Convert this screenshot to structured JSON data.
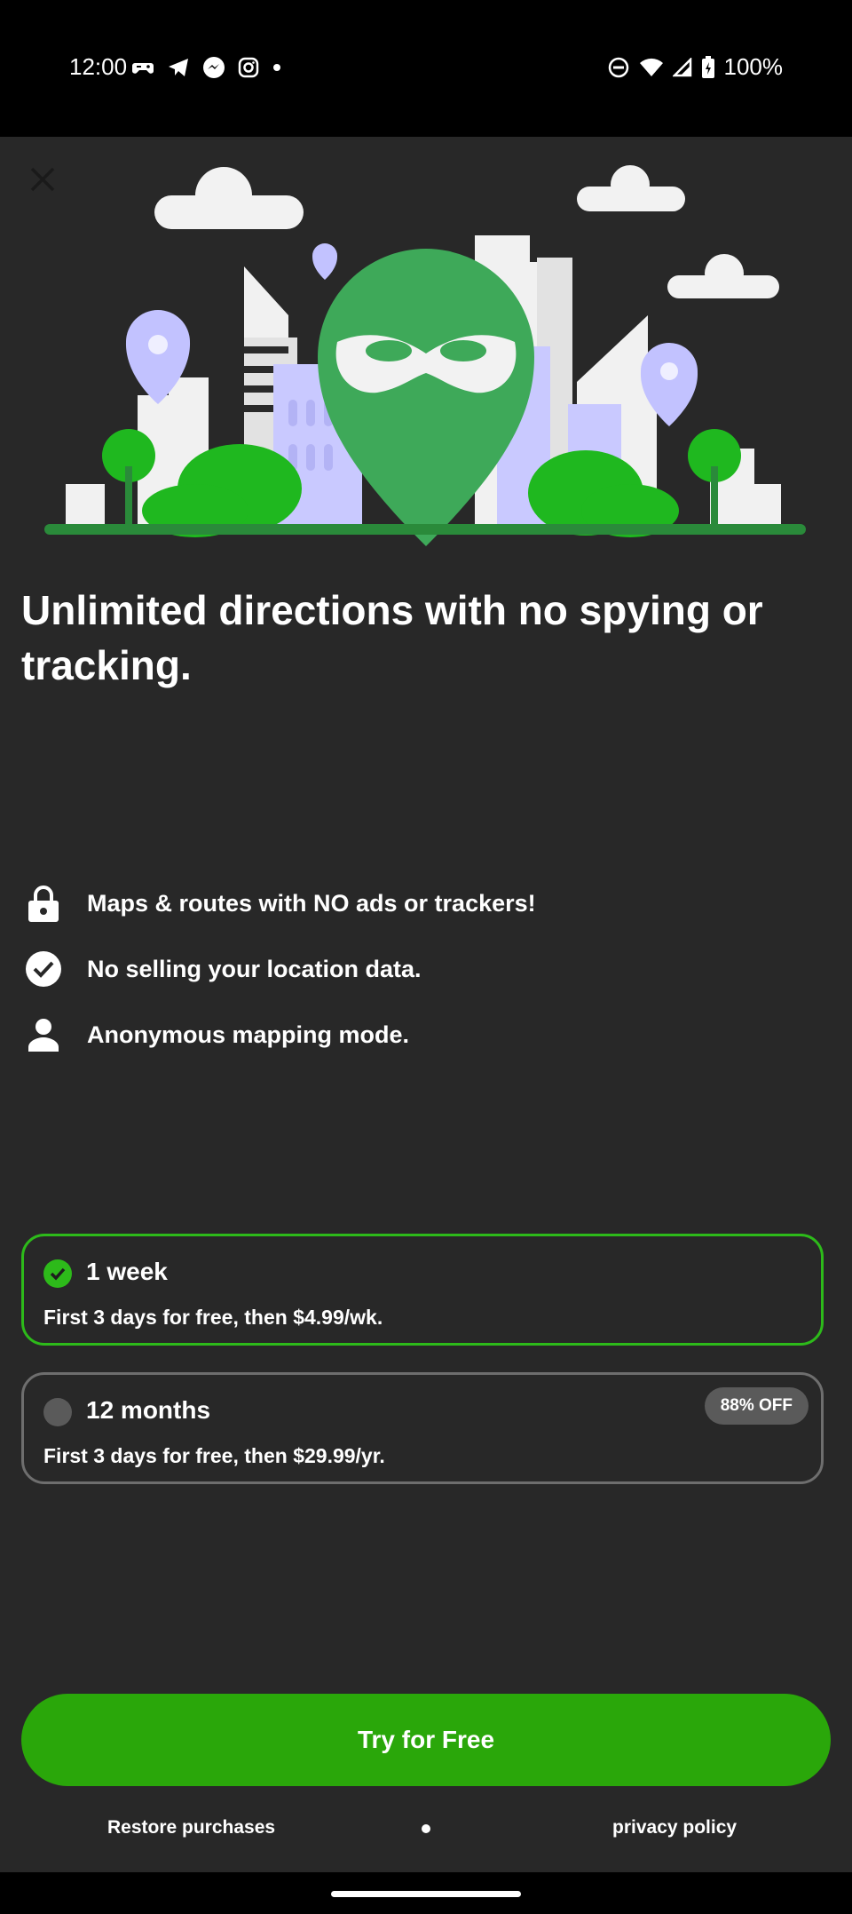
{
  "status_bar": {
    "time": "12:00",
    "battery": "100%",
    "left_icons": [
      "game-controller-icon",
      "telegram-icon",
      "messenger-icon",
      "instagram-icon",
      "dot-icon"
    ],
    "right_icons": [
      "do-not-disturb-icon",
      "wifi-icon",
      "cell-signal-icon",
      "battery-icon"
    ]
  },
  "headline": "Unlimited directions with no spying or tracking.",
  "features": [
    {
      "icon": "lock-icon",
      "text": "Maps & routes with NO ads or trackers!"
    },
    {
      "icon": "check-circle-icon",
      "text": "No selling your location data."
    },
    {
      "icon": "person-icon",
      "text": "Anonymous mapping mode."
    }
  ],
  "plans": [
    {
      "name": "1 week",
      "description": "First 3 days for free, then $4.99/wk.",
      "selected": true,
      "badge": ""
    },
    {
      "name": "12 months",
      "description": "First 3 days for free, then $29.99/yr.",
      "selected": false,
      "badge": "88% OFF"
    }
  ],
  "cta_label": "Try for Free",
  "footer": {
    "restore_label": "Restore purchases",
    "privacy_label": "privacy policy"
  },
  "colors": {
    "background": "#282828",
    "accent_green": "#2aa70a",
    "selected_border": "#2dba1a",
    "pin_green": "#3ea959"
  }
}
